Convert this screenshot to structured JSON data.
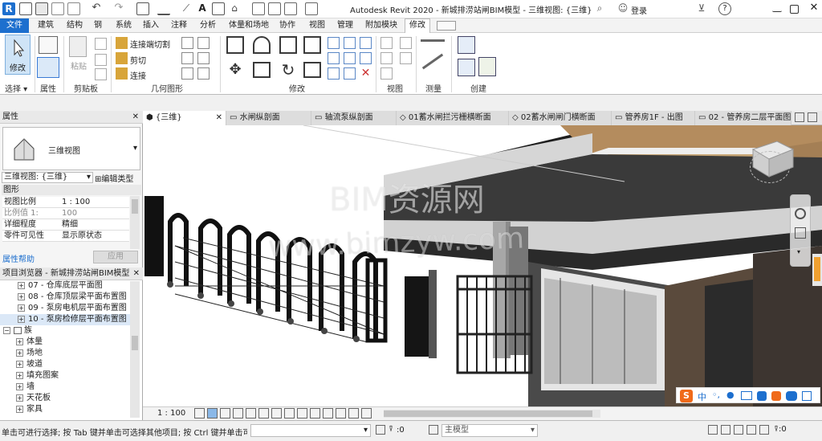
{
  "title_bar": {
    "title": "Autodesk Revit 2020 - 新城排涝站闸BIM模型 - 三维视图: {三维}",
    "login": "登录",
    "help": "?"
  },
  "ribbon_tabs": [
    "文件",
    "建筑",
    "结构",
    "钢",
    "系统",
    "插入",
    "注释",
    "分析",
    "体量和场地",
    "协作",
    "视图",
    "管理",
    "附加模块",
    "修改"
  ],
  "ribbon": {
    "modify_label": "修改",
    "select_label": "选择",
    "properties_label": "属性",
    "clipboard_label": "剪贴板",
    "paste_label": "粘贴",
    "geometry_label": "几何图形",
    "connect_cut": "连接端切割",
    "cut": "剪切",
    "join": "连接",
    "modify_panel_label": "修改",
    "view_label": "视图",
    "measure_label": "测量",
    "create_label": "创建"
  },
  "properties": {
    "header": "属性",
    "type_name": "三维视图",
    "selector": "三维视图: {三维}",
    "edit_type": "编辑类型",
    "section": "图形",
    "rows": [
      {
        "key": "视图比例",
        "value": "1 : 100"
      },
      {
        "key": "比例值 1:",
        "value": "100"
      },
      {
        "key": "详细程度",
        "value": "精细"
      },
      {
        "key": "零件可见性",
        "value": "显示原状态"
      }
    ],
    "help": "属性帮助",
    "apply": "应用"
  },
  "browser": {
    "header": "项目浏览器 - 新城排涝站闸BIM模型",
    "views": [
      "07 - 仓库底层平面图",
      "08 - 仓库顶层梁平面布置图",
      "09 - 泵房电机层平面布置图",
      "10 - 泵房检修层平面布置图"
    ],
    "family_root": "族",
    "families": [
      "体量",
      "场地",
      "坡道",
      "填充图案",
      "墙",
      "天花板",
      "家具"
    ]
  },
  "view_tabs": [
    "{三维}",
    "水闸纵剖面",
    "轴流泵纵剖面",
    "01蓄水闸拦污栅横断面",
    "02蓄水闸闸门横断面",
    "管养房1F - 出图",
    "02 - 管养房二层平面图"
  ],
  "watermark": {
    "line1": "BIM资源网",
    "line2": "www.bimzyw.com"
  },
  "view_control": {
    "scale": "1 : 100"
  },
  "ime": {
    "mode": "中"
  },
  "status": {
    "message": "单击可进行选择; 按 Tab 键并单击可选择其他项目; 按 Ctrl 键并单击可",
    "count": ":0",
    "model": "主模型"
  },
  "colors": {
    "file_tab": "#1d6fce",
    "accent": "#2a7ac6",
    "wall_gray": "#5e5e5e",
    "concrete": "#d2d2d2",
    "sand": "#b99a72",
    "dark": "#222222"
  }
}
